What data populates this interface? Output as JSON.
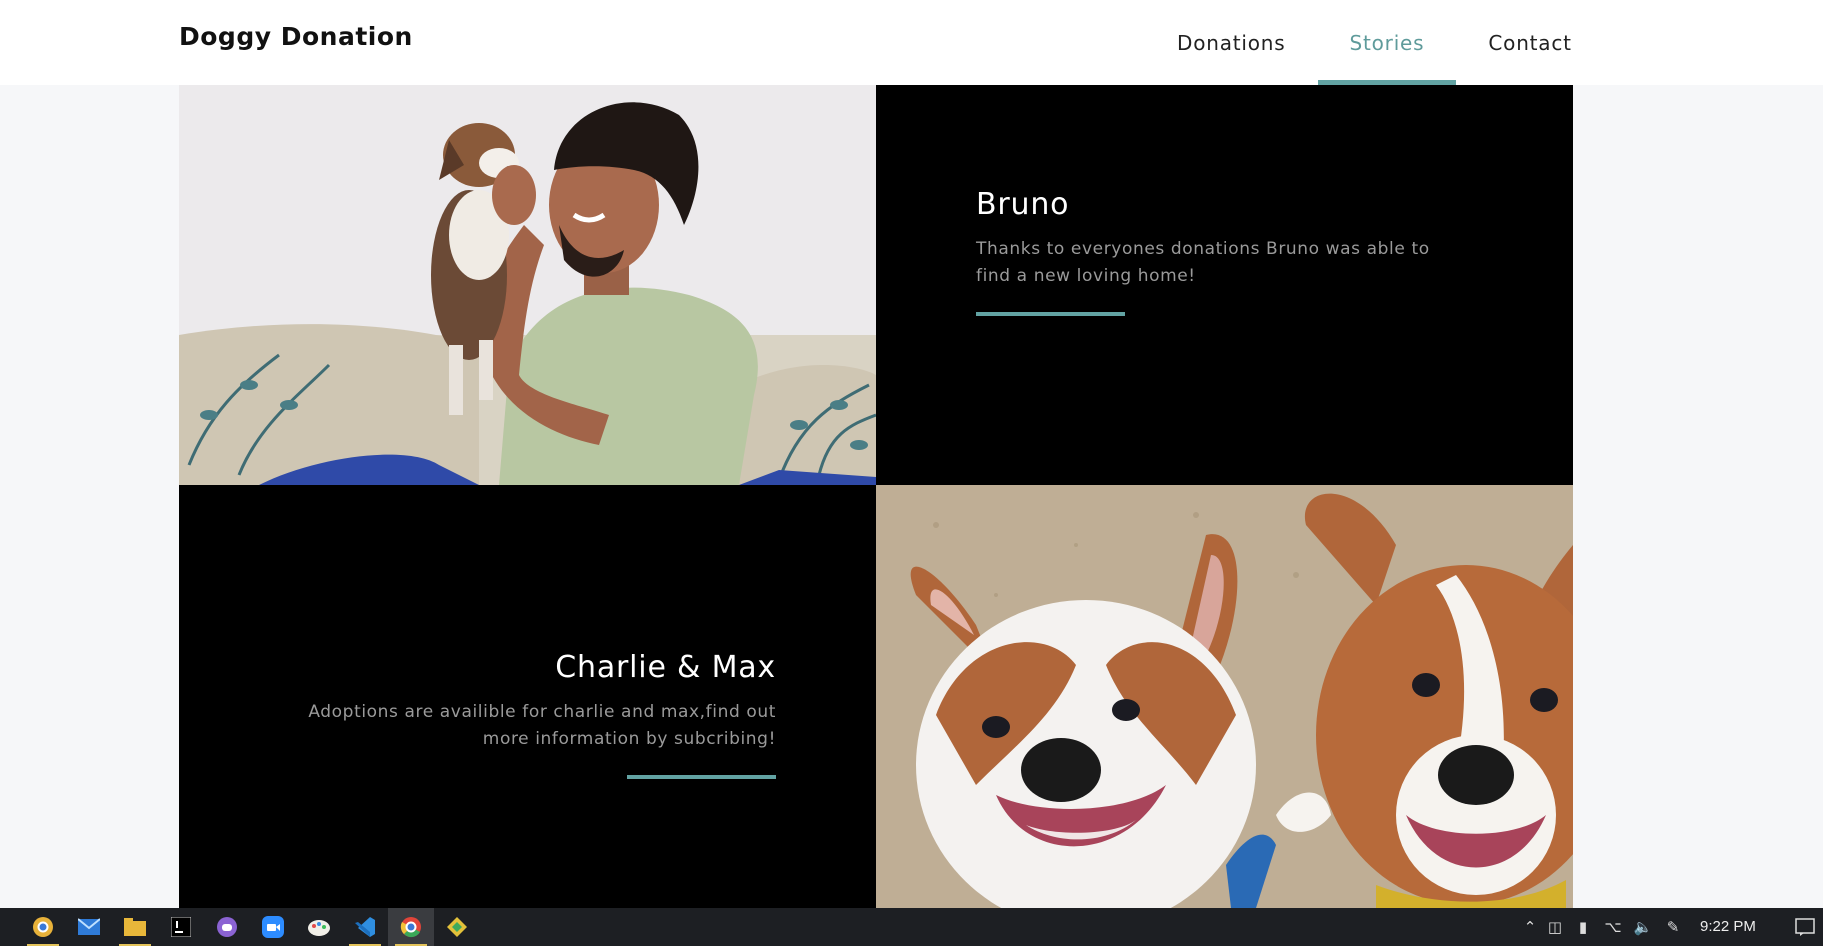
{
  "header": {
    "brand": "Doggy Donation",
    "nav": [
      {
        "label": "Donations",
        "active": false
      },
      {
        "label": "Stories",
        "active": true
      },
      {
        "label": "Contact",
        "active": false
      }
    ]
  },
  "stories": [
    {
      "title": "Bruno",
      "text": "Thanks to everyones donations Bruno was able to find a new loving home!"
    },
    {
      "title": "Charlie & Max",
      "text": "Adoptions are availible for charlie and max,find out more information by subcribing!"
    }
  ],
  "colors": {
    "accent": "#62a3a3",
    "background": "#f6f7f9",
    "panel": "#000000"
  },
  "taskbar": {
    "apps": [
      "chrome-canary-icon",
      "mail-icon",
      "file-explorer-icon",
      "intellij-icon",
      "discord-icon",
      "zoom-icon",
      "paint-icon",
      "vscode-icon",
      "chrome-icon",
      "git-kraken-icon"
    ],
    "clock": "9:22 PM"
  }
}
